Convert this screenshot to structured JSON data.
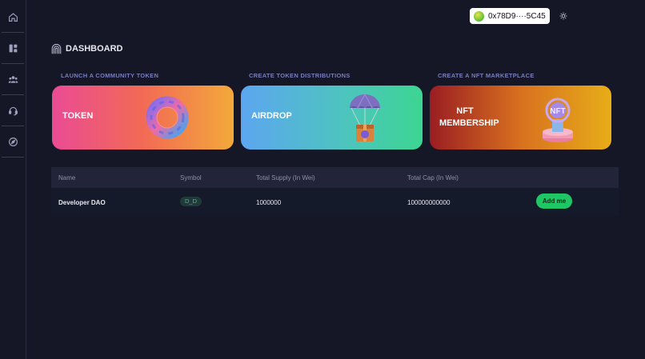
{
  "header": {
    "wallet_address": "0x78D9····5C45",
    "theme_toggle_icon": "sun-icon"
  },
  "sidebar": {
    "items": [
      {
        "icon": "home-icon"
      },
      {
        "icon": "dashboard-icon"
      },
      {
        "icon": "community-icon"
      },
      {
        "icon": "support-icon"
      },
      {
        "icon": "compass-icon"
      }
    ]
  },
  "page": {
    "title": "DASHBOARD",
    "title_icon": "arch-icon"
  },
  "sections": [
    {
      "label": "LAUNCH A COMMUNITY TOKEN",
      "card_title": "TOKEN",
      "card_art": "torus-ring-icon"
    },
    {
      "label": "CREATE TOKEN DISTRIBUTIONS",
      "card_title": "AIRDROP",
      "card_art": "parachute-box-icon"
    },
    {
      "label": "CREATE A NFT MARKETPLACE",
      "card_title_line1": "NFT",
      "card_title_line2": "MEMBERSHIP",
      "card_art": "nft-pedestal-icon"
    }
  ],
  "table": {
    "columns": [
      "Name",
      "Symbol",
      "Total Supply (In Wei)",
      "Total Cap (In Wei)"
    ],
    "rows": [
      {
        "name": "Developer DAO",
        "symbol": "D_D",
        "total_supply": "1000000",
        "total_cap": "100000000000",
        "action_label": "Add me"
      }
    ]
  },
  "colors": {
    "background": "#151626",
    "accent_label": "#7a7dbd",
    "action_green": "#1fc664"
  }
}
